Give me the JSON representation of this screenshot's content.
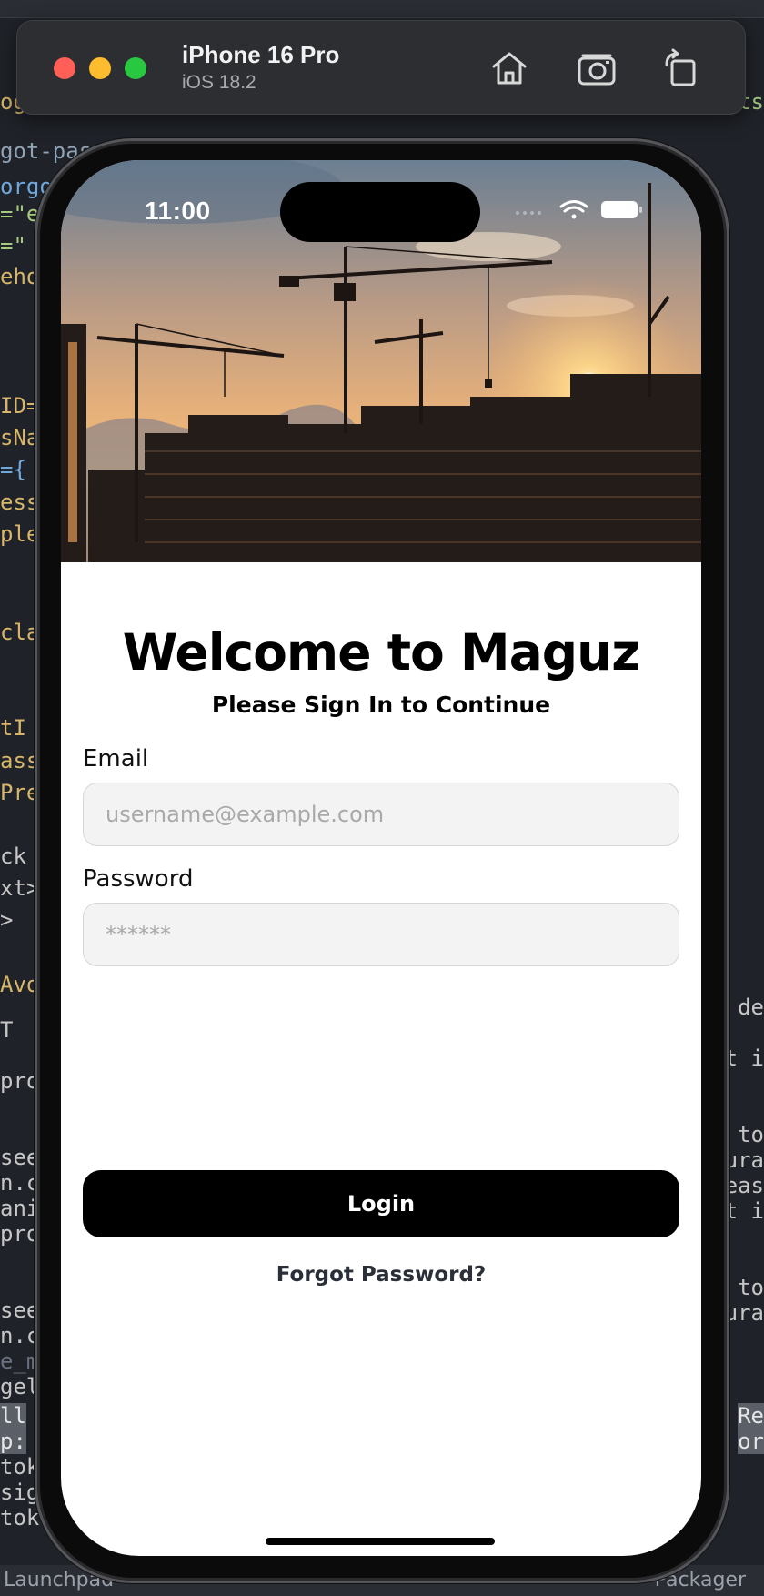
{
  "simulator": {
    "device_name": "iPhone 16 Pro",
    "os_version": "iOS 18.2"
  },
  "status_bar": {
    "time": "11:00"
  },
  "login": {
    "title": "Welcome to Maguz",
    "subtitle": "Please Sign In to Continue",
    "email_label": "Email",
    "email_placeholder": "username@example.com",
    "password_label": "Password",
    "password_placeholder": "******",
    "login_button": "Login",
    "forgot_password": "Forgot Password?"
  },
  "editor": {
    "left_lines": [
      "ogi",
      "got-pass",
      "orgot",
      "=\"em",
      "=\"",
      "eho",
      "",
      "",
      "ID=",
      "sNa",
      "={",
      "ess",
      "ple",
      "",
      "",
      "cla",
      "",
      "tI",
      "assN",
      "Pres",
      "",
      "ck t",
      "xt>",
      ">",
      "",
      "Avo",
      "T",
      "",
      "pro",
      "",
      "",
      "see",
      "n.co",
      "anin",
      "pro",
      "",
      "",
      "see",
      "n.co",
      "e_mo",
      "gele",
      "",
      "ll",
      "p:",
      "toke",
      "sign",
      "token"
    ],
    "right_lines": [
      ".ts",
      "de",
      "t i",
      "to",
      "ura",
      "eas",
      "t i",
      "to",
      "ura",
      "Re",
      "or"
    ],
    "status_left": "Launchpad",
    "status_right": "Packager"
  }
}
